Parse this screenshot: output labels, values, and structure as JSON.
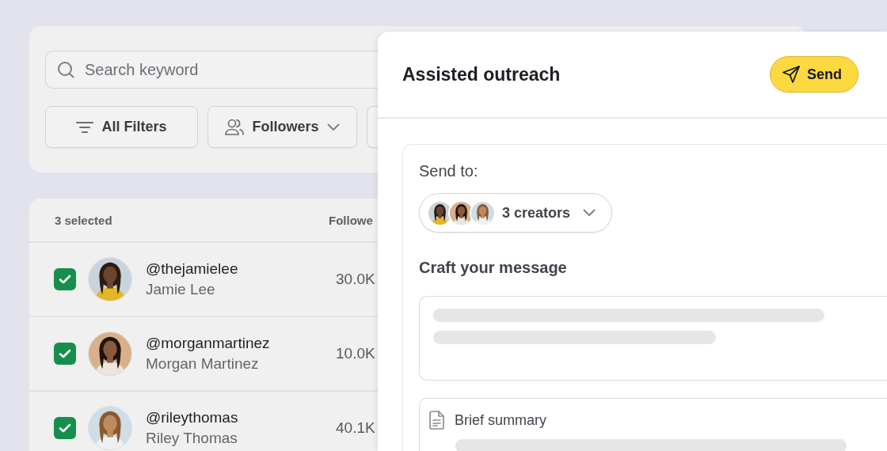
{
  "search": {
    "placeholder": "Search keyword"
  },
  "filters": [
    {
      "label": "All Filters",
      "kind": "lines"
    },
    {
      "label": "Followers",
      "kind": "people"
    }
  ],
  "table": {
    "selection": "3 selected",
    "column_2": "Followe",
    "rows": [
      {
        "checked": true,
        "handle": "@thejamielee",
        "name": "Jamie Lee",
        "followers": "30.0K"
      },
      {
        "checked": true,
        "handle": "@morganmartinez",
        "name": "Morgan Martinez",
        "followers": "10.0K"
      },
      {
        "checked": true,
        "handle": "@rileythomas",
        "name": "Riley Thomas",
        "followers": "40.1K"
      }
    ]
  },
  "panel": {
    "title": "Assisted outreach",
    "send_button": "Send",
    "send_to": {
      "label": "Send to:",
      "recipients": "3 creators"
    },
    "message": {
      "heading": "Craft your message"
    },
    "brief": {
      "label": "Brief summary"
    }
  }
}
